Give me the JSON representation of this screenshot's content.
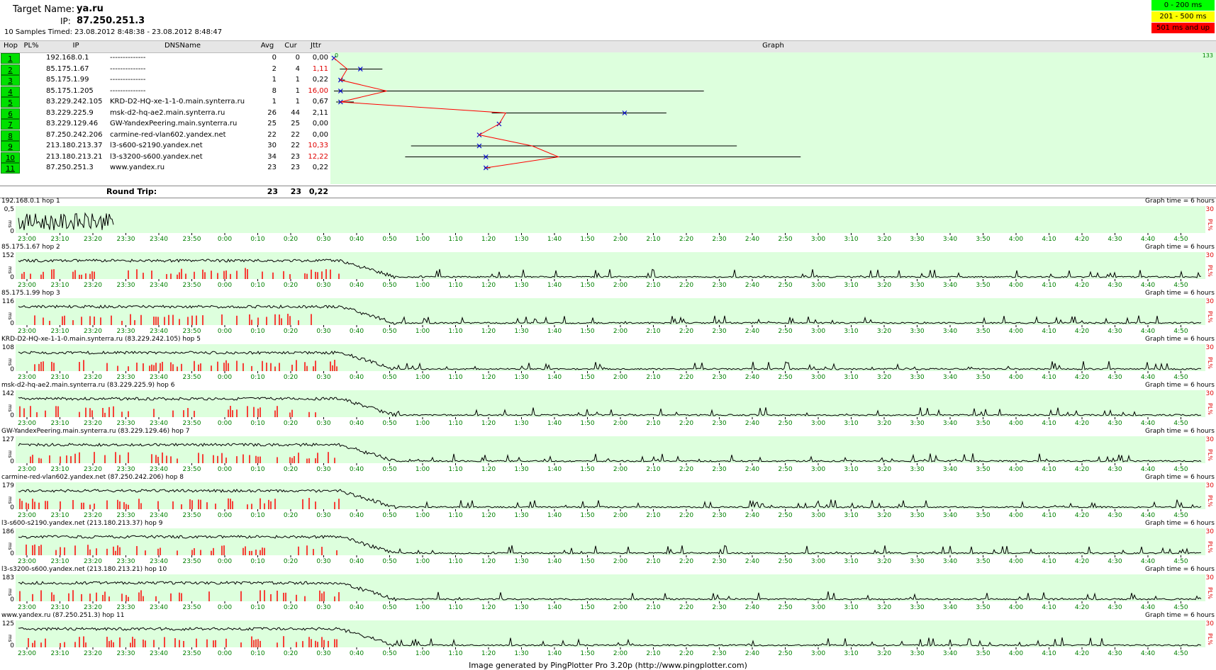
{
  "header": {
    "target_label": "Target Name:",
    "target_value": "ya.ru",
    "ip_label": "IP:",
    "ip_value": "87.250.251.3",
    "samples_text": "10 Samples Timed:  23.08.2012 8:48:38 - 23.08.2012 8:48:47"
  },
  "legend": {
    "green": "0 - 200 ms",
    "yellow": "201 - 500 ms",
    "red": "501 ms and up"
  },
  "colors": {
    "good": "#00ff00",
    "warn": "#ffff00",
    "bad": "#ff0000",
    "graph_bg": "#ddffdd",
    "pl_bar": "#ff0000",
    "time_label": "#008000"
  },
  "table": {
    "columns": [
      "Hop",
      "PL%",
      "IP",
      "DNSName",
      "Avg",
      "Cur",
      "Jttr",
      "Graph"
    ],
    "graph_min_label": "0",
    "graph_max_label": "133",
    "rows": [
      {
        "hop": "1",
        "ip": "192.168.0.1",
        "dns": "--------------",
        "avg": "0",
        "cur": "0",
        "jttr": "0,00",
        "jttr_red": false
      },
      {
        "hop": "2",
        "ip": "85.175.1.67",
        "dns": "--------------",
        "avg": "2",
        "cur": "4",
        "jttr": "1,11",
        "jttr_red": true
      },
      {
        "hop": "3",
        "ip": "85.175.1.99",
        "dns": "--------------",
        "avg": "1",
        "cur": "1",
        "jttr": "0,22",
        "jttr_red": false
      },
      {
        "hop": "4",
        "ip": "85.175.1.205",
        "dns": "--------------",
        "avg": "8",
        "cur": "1",
        "jttr": "16,00",
        "jttr_red": true
      },
      {
        "hop": "5",
        "ip": "83.229.242.105",
        "dns": "KRD-D2-HQ-xe-1-1-0.main.synterra.ru",
        "avg": "1",
        "cur": "1",
        "jttr": "0,67",
        "jttr_red": false
      },
      {
        "hop": "6",
        "ip": "83.229.225.9",
        "dns": "msk-d2-hq-ae2.main.synterra.ru",
        "avg": "26",
        "cur": "44",
        "jttr": "2,11",
        "jttr_red": false
      },
      {
        "hop": "7",
        "ip": "83.229.129.46",
        "dns": "GW-YandexPeering.main.synterra.ru",
        "avg": "25",
        "cur": "25",
        "jttr": "0,00",
        "jttr_red": false
      },
      {
        "hop": "8",
        "ip": "87.250.242.206",
        "dns": "carmine-red-vlan602.yandex.net",
        "avg": "22",
        "cur": "22",
        "jttr": "0,00",
        "jttr_red": false
      },
      {
        "hop": "9",
        "ip": "213.180.213.37",
        "dns": "l3-s600-s2190.yandex.net",
        "avg": "30",
        "cur": "22",
        "jttr": "10,33",
        "jttr_red": true
      },
      {
        "hop": "10",
        "ip": "213.180.213.21",
        "dns": "l3-s3200-s600.yandex.net",
        "avg": "34",
        "cur": "23",
        "jttr": "12,22",
        "jttr_red": true
      },
      {
        "hop": "11",
        "ip": "87.250.251.3",
        "dns": "www.yandex.ru",
        "avg": "23",
        "cur": "23",
        "jttr": "0,22",
        "jttr_red": false
      }
    ],
    "round_trip": {
      "label": "Round Trip:",
      "avg": "23",
      "cur": "23",
      "jttr": "0,22"
    }
  },
  "strips": {
    "time_label": "Graph time = 6 hours",
    "ms_label": "ms",
    "pl_label": "PL%",
    "pl_max": "30",
    "y_min": "0",
    "time_ticks": [
      "23:00",
      "23:10",
      "23:20",
      "23:30",
      "23:40",
      "23:50",
      "0:00",
      "0:10",
      "0:20",
      "0:30",
      "0:40",
      "0:50",
      "1:00",
      "1:10",
      "1:20",
      "1:30",
      "1:40",
      "1:50",
      "2:00",
      "2:10",
      "2:20",
      "2:30",
      "2:40",
      "2:50",
      "3:00",
      "3:10",
      "3:20",
      "3:30",
      "3:40",
      "3:50",
      "4:00",
      "4:10",
      "4:20",
      "4:30",
      "4:40",
      "4:50"
    ],
    "items": [
      {
        "title": "192.168.0.1 hop 1",
        "ymax": "0,5"
      },
      {
        "title": "85.175.1.67 hop 2",
        "ymax": "152"
      },
      {
        "title": "85.175.1.99 hop 3",
        "ymax": "116"
      },
      {
        "title": "KRD-D2-HQ-xe-1-1-0.main.synterra.ru (83.229.242.105) hop 5",
        "ymax": "108"
      },
      {
        "title": "msk-d2-hq-ae2.main.synterra.ru (83.229.225.9) hop 6",
        "ymax": "142"
      },
      {
        "title": "GW-YandexPeering.main.synterra.ru (83.229.129.46) hop 7",
        "ymax": "127"
      },
      {
        "title": "carmine-red-vlan602.yandex.net (87.250.242.206) hop 8",
        "ymax": "179"
      },
      {
        "title": "l3-s600-s2190.yandex.net (213.180.213.37) hop 9",
        "ymax": "186"
      },
      {
        "title": "l3-s3200-s600.yandex.net (213.180.213.21) hop 10",
        "ymax": "183"
      },
      {
        "title": "www.yandex.ru (87.250.251.3) hop 11",
        "ymax": "125"
      }
    ]
  },
  "footer": "Image generated by PingPlotter Pro 3.20p (http://www.pingplotter.com)"
}
